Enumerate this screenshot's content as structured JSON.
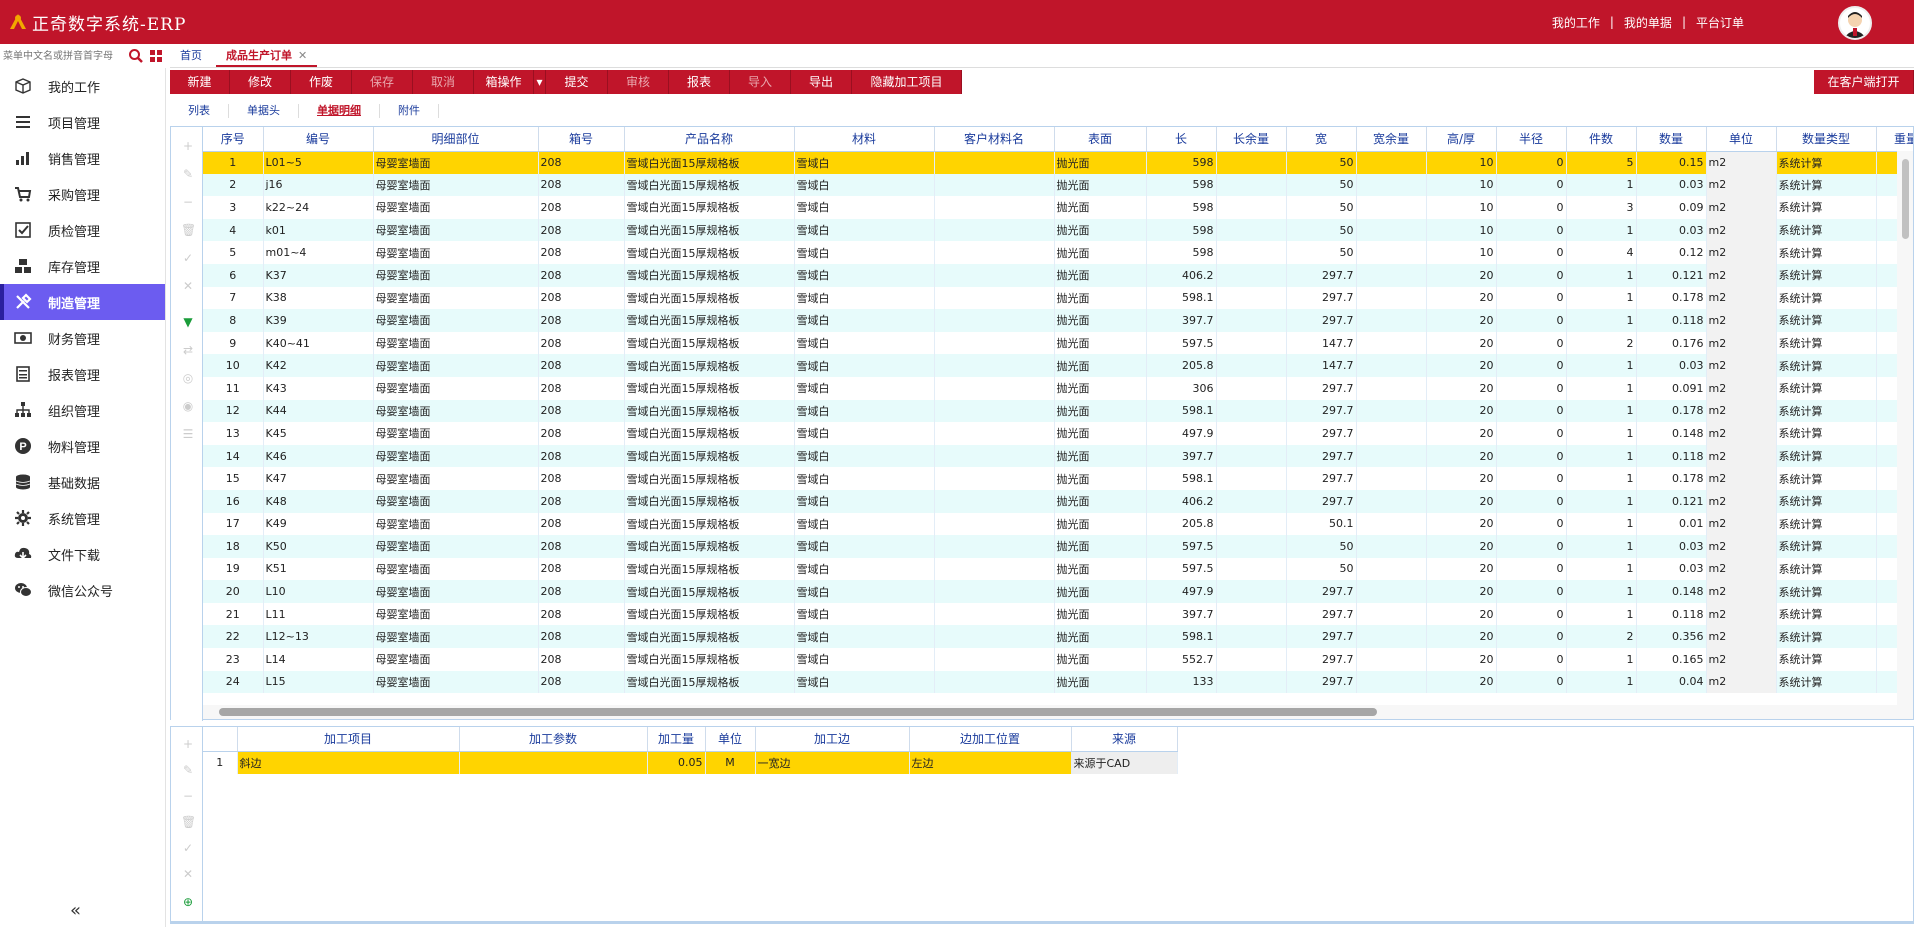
{
  "app": {
    "title": "正奇数字系统-ERP",
    "links": [
      "我的工作",
      "我的单据",
      "平台订单"
    ]
  },
  "search": {
    "placeholder": "菜单中文名或拼音首字母"
  },
  "tabs": [
    "首页",
    "成品生产订单"
  ],
  "sidebar": {
    "items": [
      {
        "label": "我的工作",
        "icon": "cube-icon"
      },
      {
        "label": "项目管理",
        "icon": "list-icon"
      },
      {
        "label": "销售管理",
        "icon": "chart-icon"
      },
      {
        "label": "采购管理",
        "icon": "cart-icon"
      },
      {
        "label": "质检管理",
        "icon": "check-icon"
      },
      {
        "label": "库存管理",
        "icon": "boxes-icon"
      },
      {
        "label": "制造管理",
        "icon": "tools-icon",
        "active": true
      },
      {
        "label": "财务管理",
        "icon": "money-icon"
      },
      {
        "label": "报表管理",
        "icon": "report-icon"
      },
      {
        "label": "组织管理",
        "icon": "org-icon"
      },
      {
        "label": "物料管理",
        "icon": "p-icon"
      },
      {
        "label": "基础数据",
        "icon": "database-icon"
      },
      {
        "label": "系统管理",
        "icon": "gear-icon"
      },
      {
        "label": "文件下载",
        "icon": "download-icon"
      },
      {
        "label": "微信公众号",
        "icon": "wechat-icon"
      }
    ],
    "collapse": "«"
  },
  "toolbar": {
    "buttons": [
      {
        "label": "新建",
        "w": 60,
        "disabled": false
      },
      {
        "label": "修改",
        "w": 61,
        "disabled": false
      },
      {
        "label": "作废",
        "w": 61,
        "disabled": false
      },
      {
        "label": "保存",
        "w": 61,
        "disabled": true
      },
      {
        "label": "取消",
        "w": 61,
        "disabled": true
      },
      {
        "label": "箱操作",
        "w": 60,
        "disabled": false
      },
      {
        "label": "▾",
        "w": 12,
        "disabled": false
      },
      {
        "label": "提交",
        "w": 62,
        "disabled": false
      },
      {
        "label": "审核",
        "w": 61,
        "disabled": true
      },
      {
        "label": "报表",
        "w": 61,
        "disabled": false
      },
      {
        "label": "导入",
        "w": 61,
        "disabled": true
      },
      {
        "label": "导出",
        "w": 61,
        "disabled": false
      },
      {
        "label": "隐藏加工项目",
        "w": 110,
        "disabled": false
      }
    ],
    "right": "在客户端打开"
  },
  "subtabs": [
    "列表",
    "单据头",
    "单据明细",
    "附件"
  ],
  "grid": {
    "columns": [
      "序号",
      "编号",
      "明细部位",
      "箱号",
      "产品名称",
      "材料",
      "客户材料名",
      "表面",
      "长",
      "长余量",
      "宽",
      "宽余量",
      "高/厚",
      "半径",
      "件数",
      "数量",
      "单位",
      "数量类型",
      "重量"
    ],
    "rows": [
      [
        "1",
        "L01~5",
        "母婴室墙面",
        "208",
        "雪域白光面15厚规格板",
        "雪域白",
        "",
        "抛光面",
        "598",
        "",
        "50",
        "",
        "10",
        "0",
        "5",
        "0.15",
        "m2",
        "系统计算"
      ],
      [
        "2",
        "j16",
        "母婴室墙面",
        "208",
        "雪域白光面15厚规格板",
        "雪域白",
        "",
        "抛光面",
        "598",
        "",
        "50",
        "",
        "10",
        "0",
        "1",
        "0.03",
        "m2",
        "系统计算"
      ],
      [
        "3",
        "k22~24",
        "母婴室墙面",
        "208",
        "雪域白光面15厚规格板",
        "雪域白",
        "",
        "抛光面",
        "598",
        "",
        "50",
        "",
        "10",
        "0",
        "3",
        "0.09",
        "m2",
        "系统计算"
      ],
      [
        "4",
        "k01",
        "母婴室墙面",
        "208",
        "雪域白光面15厚规格板",
        "雪域白",
        "",
        "抛光面",
        "598",
        "",
        "50",
        "",
        "10",
        "0",
        "1",
        "0.03",
        "m2",
        "系统计算"
      ],
      [
        "5",
        "m01~4",
        "母婴室墙面",
        "208",
        "雪域白光面15厚规格板",
        "雪域白",
        "",
        "抛光面",
        "598",
        "",
        "50",
        "",
        "10",
        "0",
        "4",
        "0.12",
        "m2",
        "系统计算"
      ],
      [
        "6",
        "K37",
        "母婴室墙面",
        "208",
        "雪域白光面15厚规格板",
        "雪域白",
        "",
        "抛光面",
        "406.2",
        "",
        "297.7",
        "",
        "20",
        "0",
        "1",
        "0.121",
        "m2",
        "系统计算"
      ],
      [
        "7",
        "K38",
        "母婴室墙面",
        "208",
        "雪域白光面15厚规格板",
        "雪域白",
        "",
        "抛光面",
        "598.1",
        "",
        "297.7",
        "",
        "20",
        "0",
        "1",
        "0.178",
        "m2",
        "系统计算"
      ],
      [
        "8",
        "K39",
        "母婴室墙面",
        "208",
        "雪域白光面15厚规格板",
        "雪域白",
        "",
        "抛光面",
        "397.7",
        "",
        "297.7",
        "",
        "20",
        "0",
        "1",
        "0.118",
        "m2",
        "系统计算"
      ],
      [
        "9",
        "K40~41",
        "母婴室墙面",
        "208",
        "雪域白光面15厚规格板",
        "雪域白",
        "",
        "抛光面",
        "597.5",
        "",
        "147.7",
        "",
        "20",
        "0",
        "2",
        "0.176",
        "m2",
        "系统计算"
      ],
      [
        "10",
        "K42",
        "母婴室墙面",
        "208",
        "雪域白光面15厚规格板",
        "雪域白",
        "",
        "抛光面",
        "205.8",
        "",
        "147.7",
        "",
        "20",
        "0",
        "1",
        "0.03",
        "m2",
        "系统计算"
      ],
      [
        "11",
        "K43",
        "母婴室墙面",
        "208",
        "雪域白光面15厚规格板",
        "雪域白",
        "",
        "抛光面",
        "306",
        "",
        "297.7",
        "",
        "20",
        "0",
        "1",
        "0.091",
        "m2",
        "系统计算"
      ],
      [
        "12",
        "K44",
        "母婴室墙面",
        "208",
        "雪域白光面15厚规格板",
        "雪域白",
        "",
        "抛光面",
        "598.1",
        "",
        "297.7",
        "",
        "20",
        "0",
        "1",
        "0.178",
        "m2",
        "系统计算"
      ],
      [
        "13",
        "K45",
        "母婴室墙面",
        "208",
        "雪域白光面15厚规格板",
        "雪域白",
        "",
        "抛光面",
        "497.9",
        "",
        "297.7",
        "",
        "20",
        "0",
        "1",
        "0.148",
        "m2",
        "系统计算"
      ],
      [
        "14",
        "K46",
        "母婴室墙面",
        "208",
        "雪域白光面15厚规格板",
        "雪域白",
        "",
        "抛光面",
        "397.7",
        "",
        "297.7",
        "",
        "20",
        "0",
        "1",
        "0.118",
        "m2",
        "系统计算"
      ],
      [
        "15",
        "K47",
        "母婴室墙面",
        "208",
        "雪域白光面15厚规格板",
        "雪域白",
        "",
        "抛光面",
        "598.1",
        "",
        "297.7",
        "",
        "20",
        "0",
        "1",
        "0.178",
        "m2",
        "系统计算"
      ],
      [
        "16",
        "K48",
        "母婴室墙面",
        "208",
        "雪域白光面15厚规格板",
        "雪域白",
        "",
        "抛光面",
        "406.2",
        "",
        "297.7",
        "",
        "20",
        "0",
        "1",
        "0.121",
        "m2",
        "系统计算"
      ],
      [
        "17",
        "K49",
        "母婴室墙面",
        "208",
        "雪域白光面15厚规格板",
        "雪域白",
        "",
        "抛光面",
        "205.8",
        "",
        "50.1",
        "",
        "20",
        "0",
        "1",
        "0.01",
        "m2",
        "系统计算"
      ],
      [
        "18",
        "K50",
        "母婴室墙面",
        "208",
        "雪域白光面15厚规格板",
        "雪域白",
        "",
        "抛光面",
        "597.5",
        "",
        "50",
        "",
        "20",
        "0",
        "1",
        "0.03",
        "m2",
        "系统计算"
      ],
      [
        "19",
        "K51",
        "母婴室墙面",
        "208",
        "雪域白光面15厚规格板",
        "雪域白",
        "",
        "抛光面",
        "597.5",
        "",
        "50",
        "",
        "20",
        "0",
        "1",
        "0.03",
        "m2",
        "系统计算"
      ],
      [
        "20",
        "L10",
        "母婴室墙面",
        "208",
        "雪域白光面15厚规格板",
        "雪域白",
        "",
        "抛光面",
        "497.9",
        "",
        "297.7",
        "",
        "20",
        "0",
        "1",
        "0.148",
        "m2",
        "系统计算"
      ],
      [
        "21",
        "L11",
        "母婴室墙面",
        "208",
        "雪域白光面15厚规格板",
        "雪域白",
        "",
        "抛光面",
        "397.7",
        "",
        "297.7",
        "",
        "20",
        "0",
        "1",
        "0.118",
        "m2",
        "系统计算"
      ],
      [
        "22",
        "L12~13",
        "母婴室墙面",
        "208",
        "雪域白光面15厚规格板",
        "雪域白",
        "",
        "抛光面",
        "598.1",
        "",
        "297.7",
        "",
        "20",
        "0",
        "2",
        "0.356",
        "m2",
        "系统计算"
      ],
      [
        "23",
        "L14",
        "母婴室墙面",
        "208",
        "雪域白光面15厚规格板",
        "雪域白",
        "",
        "抛光面",
        "552.7",
        "",
        "297.7",
        "",
        "20",
        "0",
        "1",
        "0.165",
        "m2",
        "系统计算"
      ],
      [
        "24",
        "L15",
        "母婴室墙面",
        "208",
        "雪域白光面15厚规格板",
        "雪域白",
        "",
        "抛光面",
        "133",
        "",
        "297.7",
        "",
        "20",
        "0",
        "1",
        "0.04",
        "m2",
        "系统计算"
      ]
    ]
  },
  "subgrid": {
    "columns": [
      "加工项目",
      "加工参数",
      "加工量",
      "单位",
      "加工边",
      "边加工位置",
      "来源"
    ],
    "rows": [
      [
        "1",
        "斜边",
        "",
        "0.05",
        "M",
        "一宽边",
        "左边",
        "来源于CAD"
      ]
    ]
  },
  "colors": {
    "brand": "#c0152a",
    "active_nav": "#6c5cf0",
    "selected_row": "#ffd400",
    "stripe": "#e7fbfb",
    "header_text": "#1a3b9c"
  }
}
